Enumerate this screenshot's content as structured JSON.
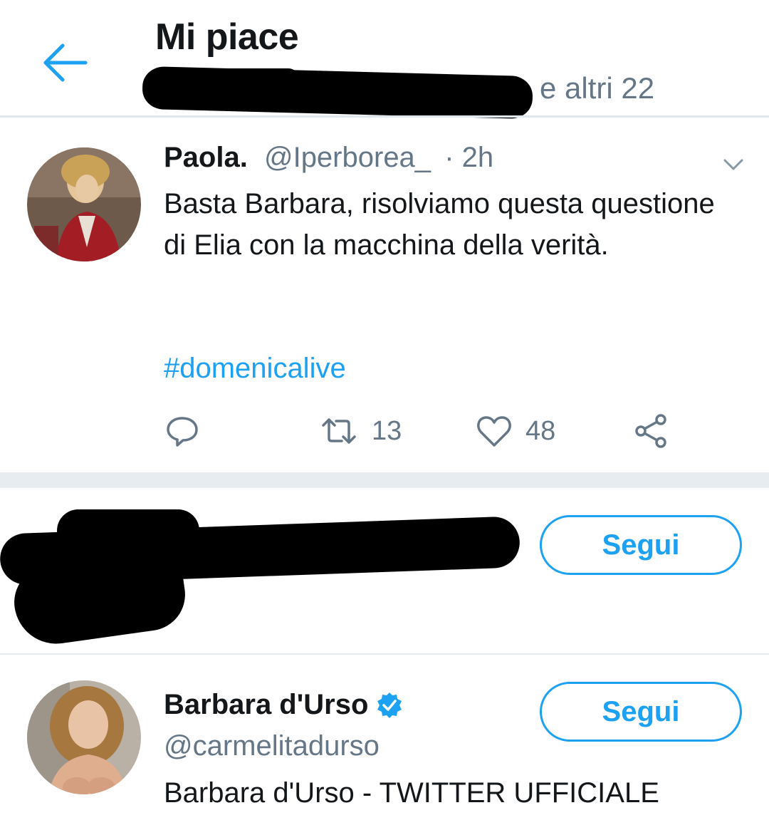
{
  "header": {
    "title": "Mi piace",
    "subtitle_tail": "e altri 22"
  },
  "tweet": {
    "name": "Paola.",
    "handle": "@Iperborea_",
    "time": "· 2h",
    "text": "Basta Barbara, risolviamo questa questione di Elia con la macchina della verità.",
    "hashtag": "#domenicalive",
    "retweets": "13",
    "likes": "48"
  },
  "users": [
    {
      "follow_label": "Segui"
    },
    {
      "name": "Barbara d'Urso",
      "handle": "@carmelitadurso",
      "bio": "Barbara d'Urso - TWITTER UFFICIALE",
      "follow_label": "Segui"
    }
  ],
  "colors": {
    "accent": "#1da1f2",
    "secondary_text": "#657786",
    "separator": "#e6ecf0"
  },
  "icons": [
    "back-arrow-icon",
    "chevron-down-icon",
    "reply-icon",
    "retweet-icon",
    "heart-icon",
    "share-icon",
    "verified-badge-icon"
  ]
}
